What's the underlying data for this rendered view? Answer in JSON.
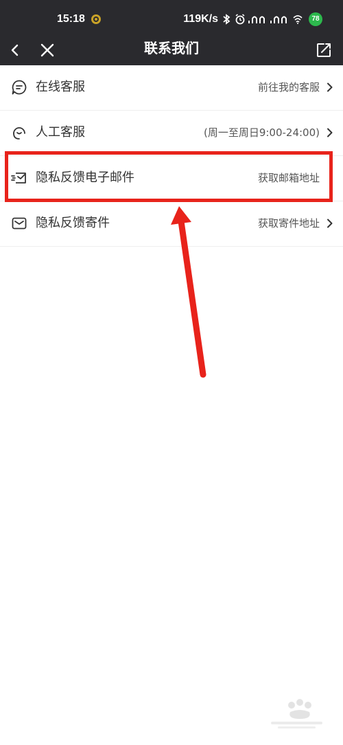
{
  "status_bar": {
    "time": "15:18",
    "network_speed": "119K/s",
    "battery": "78",
    "icons": [
      "app-notification-icon",
      "bluetooth-icon",
      "alarm-icon",
      "signal-icon",
      "signal-icon",
      "wifi-icon"
    ]
  },
  "nav": {
    "title": "联系我们",
    "back_icon": "chevron-left-icon",
    "close_icon": "close-icon",
    "share_icon": "share-icon"
  },
  "menu": {
    "items": [
      {
        "icon": "chat-icon",
        "label": "在线客服",
        "value": "前往我的客服",
        "chevron": true
      },
      {
        "icon": "headset-icon",
        "label": "人工客服",
        "value": "(周一至周日9:00-24:00)",
        "chevron": true
      },
      {
        "icon": "email-icon",
        "label": "隐私反馈电子邮件",
        "value": "获取邮箱地址",
        "chevron": false
      },
      {
        "icon": "mail-envelope-icon",
        "label": "隐私反馈寄件",
        "value": "获取寄件地址",
        "chevron": true
      }
    ]
  },
  "annotation": {
    "highlight_color": "#e8231b",
    "arrow_color": "#e8231b"
  },
  "colors": {
    "header_bg": "#2a2a2e",
    "text_primary": "#333333",
    "text_secondary": "#555555"
  }
}
